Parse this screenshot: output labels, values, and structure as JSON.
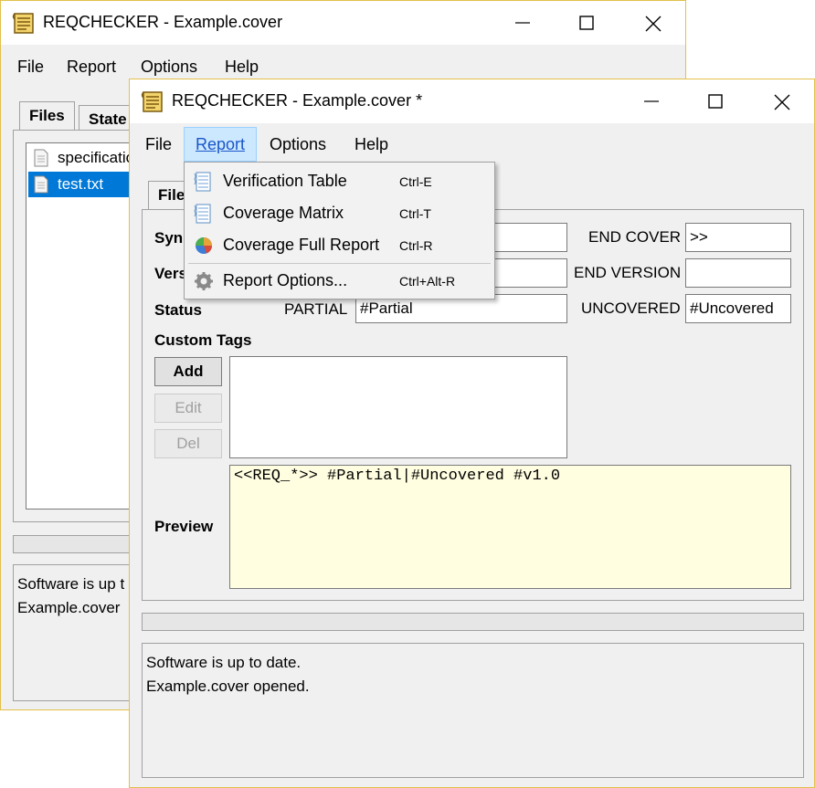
{
  "back_window": {
    "title": "REQCHECKER - Example.cover",
    "menu": [
      "File",
      "Report",
      "Options",
      "Help"
    ],
    "tabs": [
      "Files",
      "State"
    ],
    "files": [
      "specificatio",
      "test.txt"
    ],
    "status_lines": [
      "Software is up t",
      "Example.cover"
    ]
  },
  "front_window": {
    "title": "REQCHECKER - Example.cover *",
    "menu": [
      "File",
      "Report",
      "Options",
      "Help"
    ],
    "active_menu": "Report",
    "tab": "File",
    "labels": {
      "syn": "Syn",
      "vers": "Vers",
      "status": "Status",
      "partial": "PARTIAL",
      "end_cover": "END COVER",
      "end_version": "END VERSION",
      "uncovered": "UNCOVERED",
      "custom_tags": "Custom Tags",
      "preview": "Preview"
    },
    "fields": {
      "syn_value": "",
      "vers_value": "",
      "partial_value": "#Partial",
      "end_cover_value": ">>",
      "end_version_value": "",
      "uncovered_value": "#Uncovered"
    },
    "buttons": {
      "add": "Add",
      "edit": "Edit",
      "del": "Del"
    },
    "preview_text": "<<REQ_*>> #Partial|#Uncovered #v1.0",
    "status_lines": [
      "Software is up to date.",
      "Example.cover opened."
    ]
  },
  "report_menu": {
    "items": [
      {
        "label": "Verification Table",
        "shortcut": "Ctrl-E",
        "icon": "table-icon"
      },
      {
        "label": "Coverage Matrix",
        "shortcut": "Ctrl-T",
        "icon": "matrix-icon"
      },
      {
        "label": "Coverage Full Report",
        "shortcut": "Ctrl-R",
        "icon": "pie-chart-icon"
      },
      {
        "label": "Report Options...",
        "shortcut": "Ctrl+Alt-R",
        "icon": "gear-icon"
      }
    ]
  },
  "colors": {
    "window_border": "#e3c04a",
    "selection": "#0078d7",
    "menu_highlight": "#cce8ff",
    "preview_bg": "#fffee0"
  }
}
